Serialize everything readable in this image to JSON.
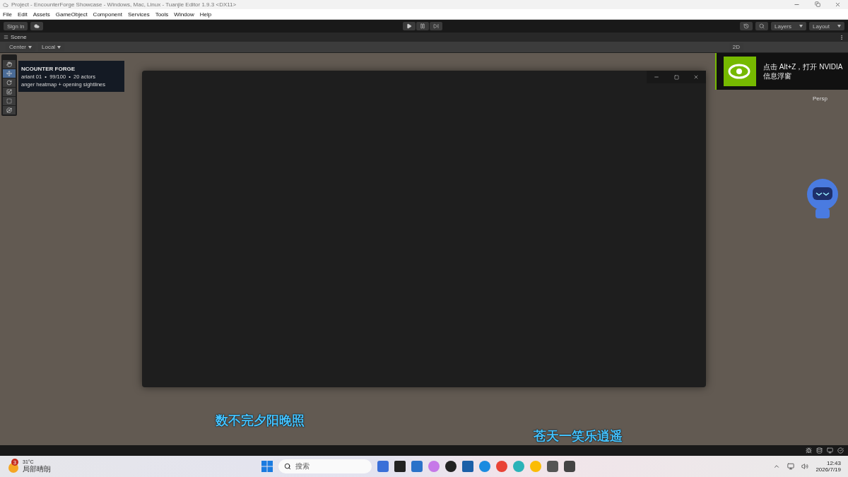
{
  "window": {
    "title": "Project - EncounterForge Showcase - Windows, Mac, Linux - Tuanjie Editor 1.9.3 <DX11>"
  },
  "menu": [
    "File",
    "Edit",
    "Assets",
    "GameObject",
    "Component",
    "Services",
    "Tools",
    "Window",
    "Help"
  ],
  "toolbar": {
    "sign_in": "Sign in",
    "layers": "Layers",
    "layout": "Layout"
  },
  "scene_tab": {
    "label": "Scene"
  },
  "scene_toolbar": {
    "pivot": "Center",
    "space": "Local",
    "mode_2d": "2D"
  },
  "tools": [
    {
      "kind": "hand",
      "selected": false
    },
    {
      "kind": "move",
      "selected": true
    },
    {
      "kind": "rotate",
      "selected": false
    },
    {
      "kind": "scale",
      "selected": false
    },
    {
      "kind": "rect",
      "selected": false
    },
    {
      "kind": "transform",
      "selected": false
    }
  ],
  "info_panel": {
    "title": "NCOUNTER FORGE",
    "stats": "ariant 01  •  99/100  •  20 actors",
    "subtitle": "anger heatmap + opening sightlines"
  },
  "notification": {
    "text": "点击 Alt+Z，打开 NVIDIA 信息浮窗"
  },
  "persp_label": "Persp",
  "subtitles": [
    "数不完夕阳晚照",
    "苍天一笑乐逍遥"
  ],
  "taskbar": {
    "weather_badge": "3",
    "temperature": "31°C",
    "condition": "局部晴朗",
    "search_placeholder": "搜索",
    "time": "12:43",
    "date": "2026/7/19"
  }
}
